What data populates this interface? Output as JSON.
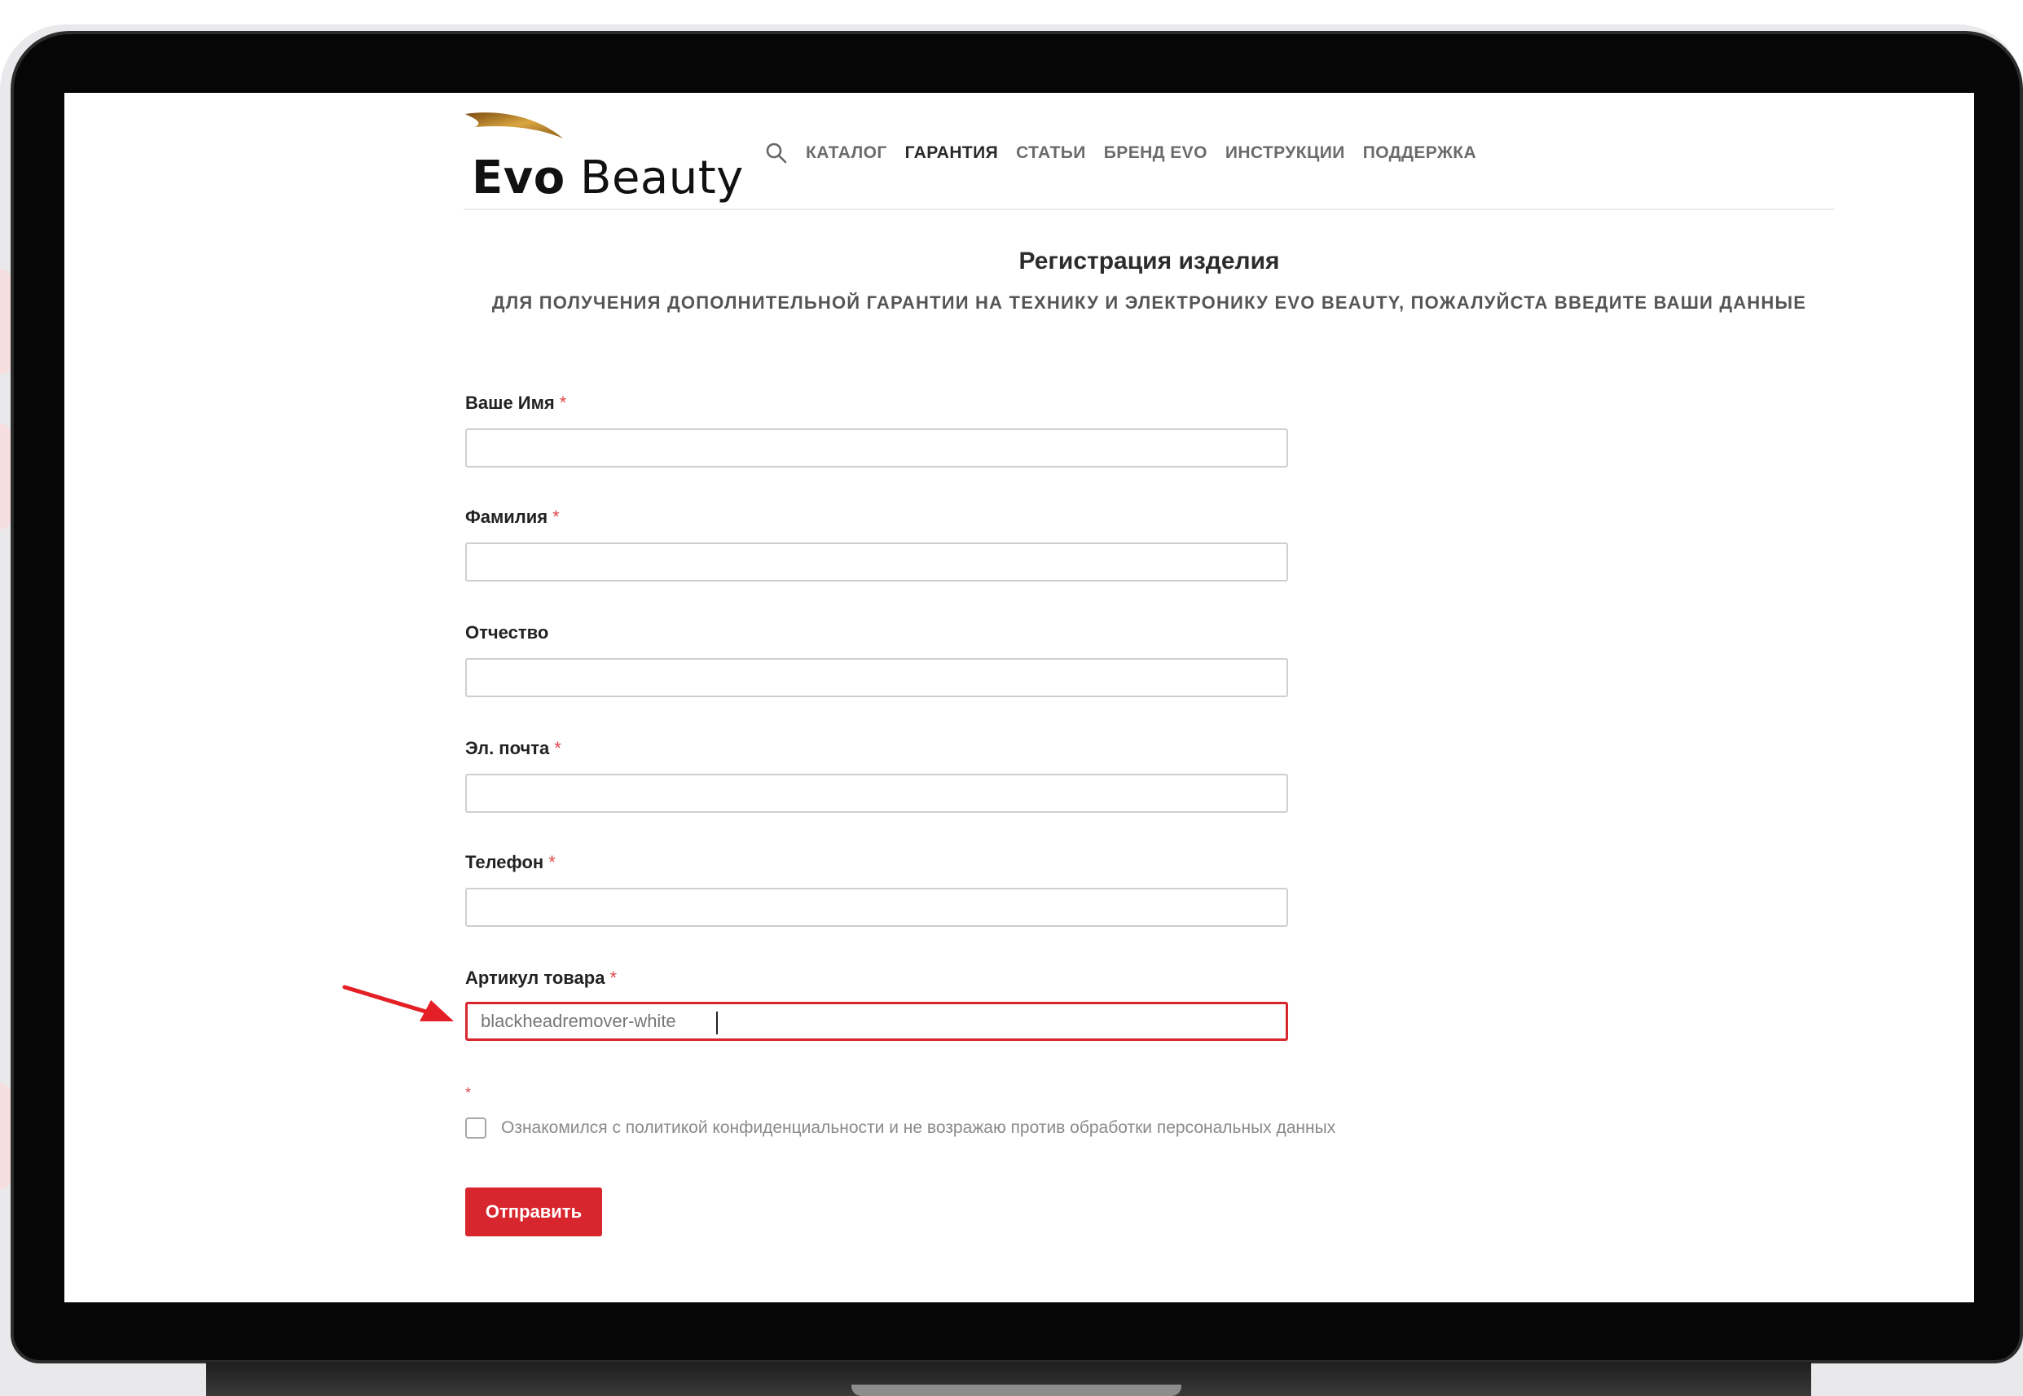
{
  "header": {
    "logo": {
      "brand_bold": "Evo",
      "brand_light": "Beauty"
    },
    "nav_items": [
      "КАТАЛОГ",
      "ГАРАНТИЯ",
      "СТАТЬИ",
      "БРЕНД EVO",
      "ИНСТРУКЦИИ",
      "ПОДДЕРЖКА"
    ],
    "active_nav": "ГАРАНТИЯ"
  },
  "form": {
    "title": "Регистрация изделия",
    "subtitle": "ДЛЯ ПОЛУЧЕНИЯ ДОПОЛНИТЕЛЬНОЙ ГАРАНТИИ НА ТЕХНИКУ И ЭЛЕКТРОНИКУ EVO BEAUTY, ПОЖАЛУЙСТА ВВЕДИТЕ ВАШИ ДАННЫЕ",
    "fields": [
      {
        "label": "Ваше Имя",
        "required": "*",
        "value": ""
      },
      {
        "label": "Фамилия",
        "required": "*",
        "value": ""
      },
      {
        "label": "Отчество",
        "required": "",
        "value": ""
      },
      {
        "label": "Эл. почта",
        "required": "*",
        "value": ""
      },
      {
        "label": "Телефон",
        "required": "*",
        "value": ""
      },
      {
        "label": "Артикул товара",
        "required": "*",
        "value": "blackheadremover-white"
      }
    ],
    "consent_required": "*",
    "consent_text": "Ознакомился с политикой конфиденциальности и не возражаю против обработки персональных данных",
    "consent_checked": false,
    "submit_label": "Отправить"
  },
  "colors": {
    "accent": "#d8262f",
    "required_mark": "#e0484d",
    "logo_gold": "#c9962a"
  }
}
